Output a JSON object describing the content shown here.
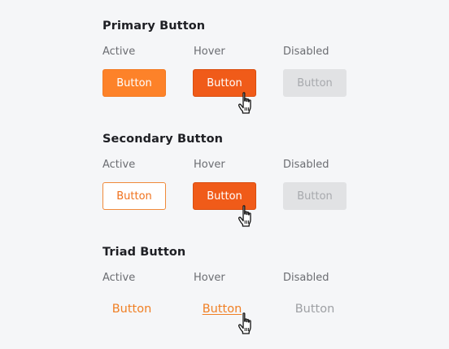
{
  "sections": [
    {
      "title": "Primary Button",
      "states": [
        "Active",
        "Hover",
        "Disabled"
      ],
      "buttons": [
        "Button",
        "Button",
        "Button"
      ]
    },
    {
      "title": "Secondary Button",
      "states": [
        "Active",
        "Hover",
        "Disabled"
      ],
      "buttons": [
        "Button",
        "Button",
        "Button"
      ]
    },
    {
      "title": "Triad Button",
      "states": [
        "Active",
        "Hover",
        "Disabled"
      ],
      "buttons": [
        "Button",
        "Button",
        "Button"
      ]
    }
  ],
  "icons": {
    "cursor": "hand-pointer-icon"
  },
  "colors": {
    "primary": "#fd8229",
    "hover": "#f05b19",
    "disabled_bg": "#e1e2e4",
    "disabled_text": "#a7a9ad",
    "secondary_border": "#f08a3a",
    "text_link": "#f07f24",
    "background": "#f5f6f8"
  }
}
